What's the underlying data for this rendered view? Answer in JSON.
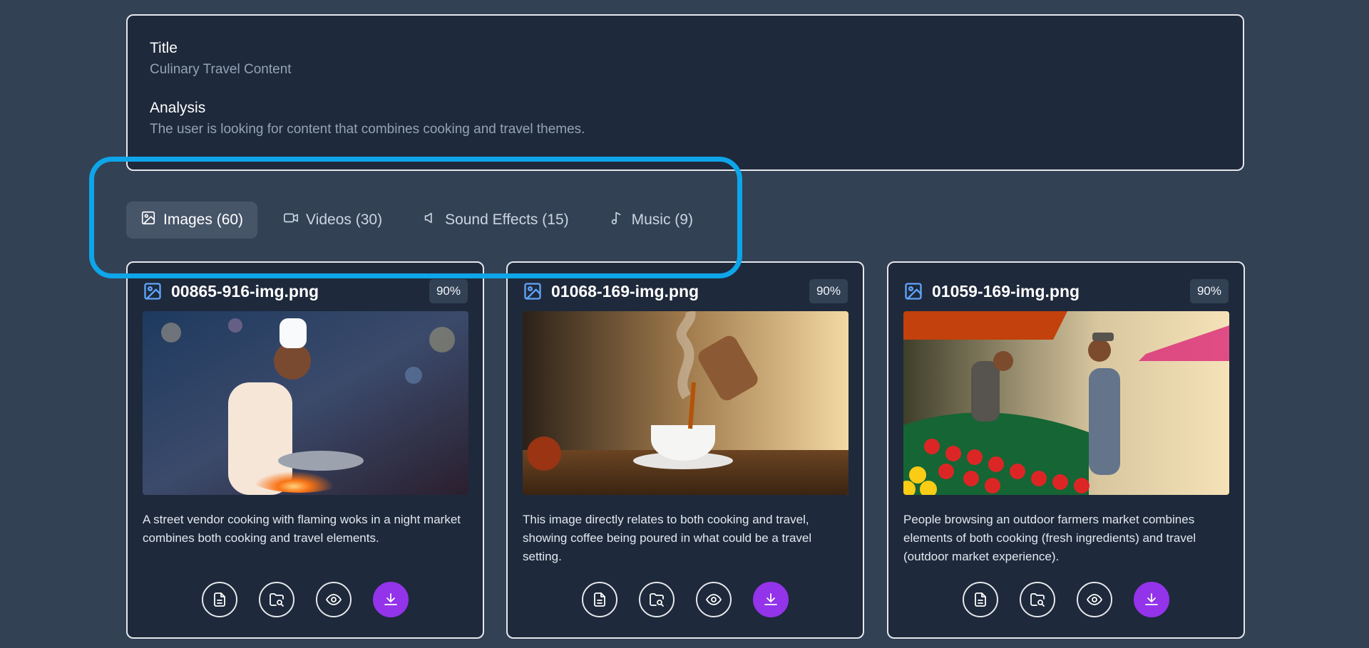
{
  "summary": {
    "title_label": "Title",
    "title_value": "Culinary Travel Content",
    "analysis_label": "Analysis",
    "analysis_value": "The user is looking for content that combines cooking and travel themes."
  },
  "tabs": [
    {
      "label": "Images (60)",
      "icon": "image-icon",
      "active": true
    },
    {
      "label": "Videos (30)",
      "icon": "video-icon",
      "active": false
    },
    {
      "label": "Sound Effects (15)",
      "icon": "speaker-icon",
      "active": false
    },
    {
      "label": "Music (9)",
      "icon": "music-note-icon",
      "active": false
    }
  ],
  "colors": {
    "page_bg": "#334155",
    "panel_bg": "#1e293b",
    "accent_highlight": "#0ea5e9",
    "download_button": "#9333ea",
    "file_icon": "#60a5fa"
  },
  "cards": [
    {
      "filename": "00865-916-img.png",
      "score": "90%",
      "description": "A street vendor cooking with flaming woks in a night market combines both cooking and travel elements.",
      "image_subject": "chef cooking with flaming wok at night market"
    },
    {
      "filename": "01068-169-img.png",
      "score": "90%",
      "description": "This image directly relates to both cooking and travel, showing coffee being poured in what could be a travel setting.",
      "image_subject": "coffee being poured into a steaming cup"
    },
    {
      "filename": "01059-169-img.png",
      "score": "90%",
      "description": "People browsing an outdoor farmers market combines elements of both cooking (fresh ingredients) and travel (outdoor market experience).",
      "image_subject": "outdoor farmers market with tomatoes and peppers"
    }
  ],
  "card_actions": [
    "document-icon",
    "folder-search-icon",
    "eye-icon",
    "download-icon"
  ]
}
